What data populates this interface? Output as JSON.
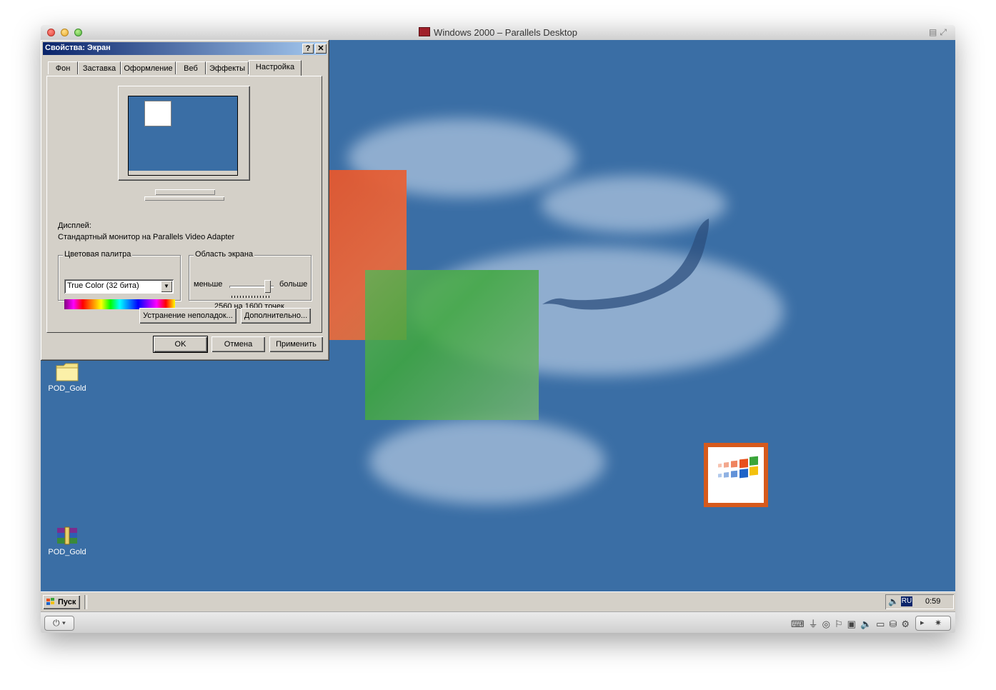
{
  "mac_window": {
    "title": "Windows 2000 – Parallels Desktop"
  },
  "dialog": {
    "title": "Свойства: Экран",
    "help_btn": "?",
    "close_btn": "✕",
    "tabs": [
      {
        "label": "Фон"
      },
      {
        "label": "Заставка"
      },
      {
        "label": "Оформление"
      },
      {
        "label": "Веб"
      },
      {
        "label": "Эффекты"
      },
      {
        "label": "Настройка"
      }
    ],
    "active_tab": "Настройка",
    "display_label": "Дисплей:",
    "display_value": "Стандартный монитор на Parallels Video Adapter",
    "color_group": {
      "caption": "Цветовая палитра",
      "selected": "True Color (32 бита)"
    },
    "area_group": {
      "caption": "Область экрана",
      "less": "меньше",
      "more": "больше",
      "resolution": "2560 на 1600 точек",
      "slider_level": 1.0
    },
    "troubleshoot_btn": "Устранение неполадок...",
    "advanced_btn": "Дополнительно...",
    "ok_btn": "OK",
    "cancel_btn": "Отмена",
    "apply_btn": "Применить"
  },
  "desktop": {
    "icons": [
      {
        "label": "POD_Gold",
        "icon": "folder-icon"
      },
      {
        "label": "POD_Gold",
        "icon": "winrar-archive-icon"
      }
    ]
  },
  "taskbar": {
    "start_label": "Пуск",
    "lang": "RU",
    "clock": "0:59"
  },
  "colors": {
    "desktop_bg": "#3a6ea5",
    "title_gradient_start": "#0a246a",
    "title_gradient_end": "#a6caf0",
    "face": "#d4d0c8"
  }
}
